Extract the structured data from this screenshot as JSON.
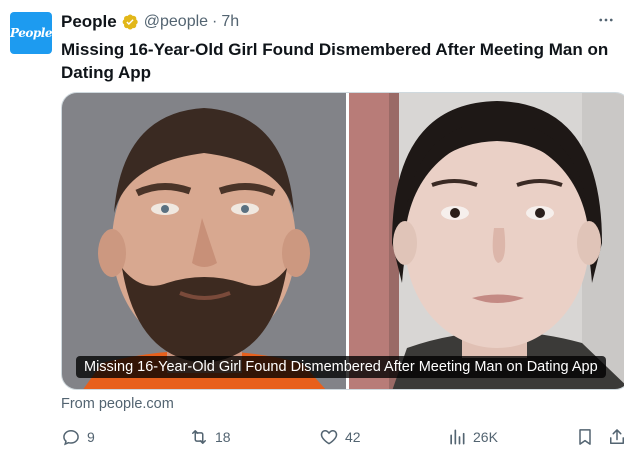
{
  "tweet": {
    "author_name": "People",
    "handle": "@people",
    "separator": "·",
    "time": "7h",
    "avatar_text": "People",
    "headline": "Missing 16-Year-Old Girl Found Dismembered After Meeting Man on Dating App",
    "media_caption": "Missing 16-Year-Old Girl Found Dismembered After Meeting Man on Dating App",
    "source": "From people.com"
  },
  "actions": {
    "replies": "9",
    "reposts": "18",
    "likes": "42",
    "views": "26K"
  },
  "icons": {
    "verified": "gold-verified-badge-icon",
    "more": "more-horizontal-icon",
    "reply": "reply-icon",
    "repost": "repost-icon",
    "like": "heart-icon",
    "views": "views-icon",
    "bookmark": "bookmark-icon",
    "share": "share-icon"
  },
  "colors": {
    "brand_blue": "#1d9bf0",
    "verified_gold": "#e2b719",
    "secondary_text": "#536471"
  }
}
